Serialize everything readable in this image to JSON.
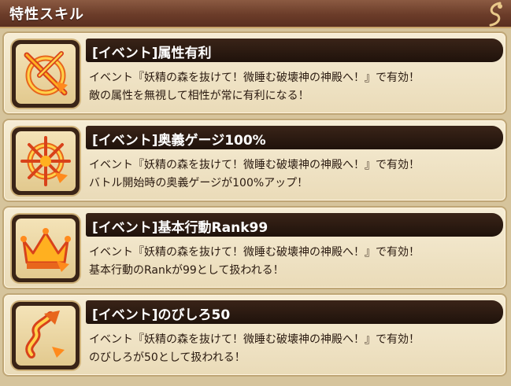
{
  "header": {
    "title": "特性スキル"
  },
  "skills": [
    {
      "title": "[イベント]属性有利",
      "icon": "attribute-advantage-icon",
      "desc_line1": "イベント『妖精の森を抜けて！微睡む破壊神の神殿へ！』で有効！",
      "desc_line2": "敵の属性を無視して相性が常に有利になる！"
    },
    {
      "title": "[イベント]奥義ゲージ100%",
      "icon": "ougi-gauge-icon",
      "desc_line1": "イベント『妖精の森を抜けて！微睡む破壊神の神殿へ！』で有効！",
      "desc_line2": "バトル開始時の奥義ゲージが100%アップ！"
    },
    {
      "title": "[イベント]基本行動Rank99",
      "icon": "crown-icon",
      "desc_line1": "イベント『妖精の森を抜けて！微睡む破壊神の神殿へ！』で有効！",
      "desc_line2": "基本行動のRankが99として扱われる！"
    },
    {
      "title": "[イベント]のびしろ50",
      "icon": "growth-arrow-icon",
      "desc_line1": "イベント『妖精の森を抜けて！微睡む破壊神の神殿へ！』で有効！",
      "desc_line2": "のびしろが50として扱われる！"
    }
  ]
}
